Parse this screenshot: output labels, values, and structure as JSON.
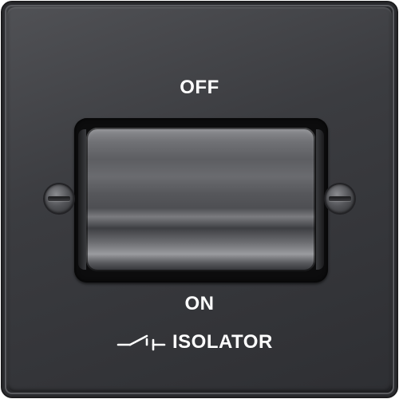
{
  "labels": {
    "off": "OFF",
    "on": "ON",
    "isolator": "ISOLATOR"
  },
  "icons": {
    "switch_symbol": "isolator-switch-icon",
    "screws": [
      "screw-icon",
      "screw-icon"
    ]
  },
  "colors": {
    "plate": "#3a3b3f",
    "text": "#ffffff",
    "surround": "#0c0c0d"
  }
}
